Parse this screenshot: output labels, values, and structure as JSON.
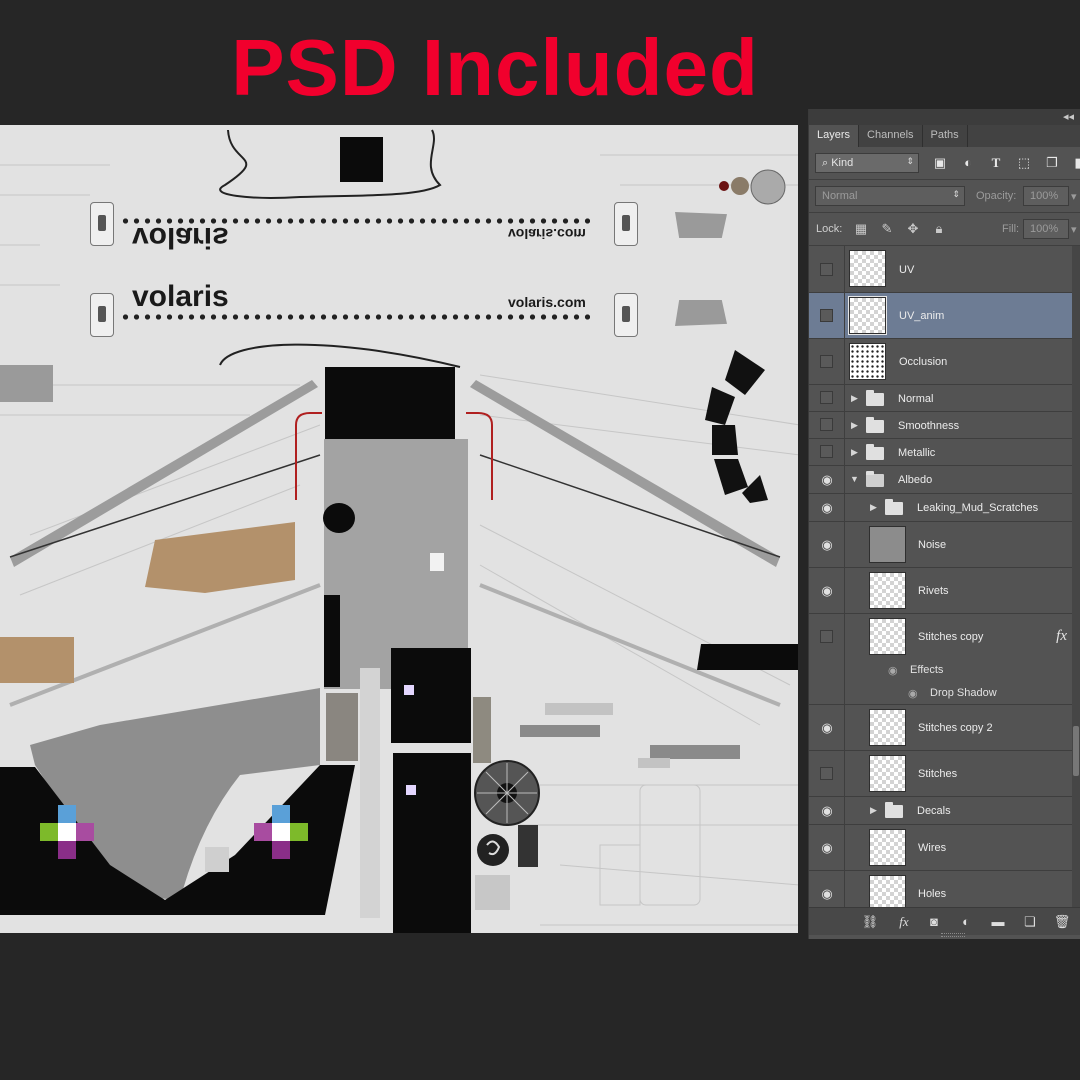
{
  "headline": "PSD Included",
  "texture": {
    "livery_brand": "volaris",
    "livery_url": "volaris.com"
  },
  "panel": {
    "tabs": [
      {
        "label": "Layers",
        "active": true
      },
      {
        "label": "Channels",
        "active": false
      },
      {
        "label": "Paths",
        "active": false
      }
    ],
    "filter": {
      "kind_label": "Kind",
      "icons": [
        "image-filter-icon",
        "adjustment-filter-icon",
        "type-filter-icon",
        "shape-filter-icon",
        "smart-object-filter-icon"
      ]
    },
    "blend_mode": "Normal",
    "opacity_label": "Opacity:",
    "opacity_value": "100%",
    "lock_label": "Lock:",
    "fill_label": "Fill:",
    "fill_value": "100%",
    "layers": [
      {
        "name": "UV",
        "type": "layer",
        "visible": false,
        "thumb": "checker"
      },
      {
        "name": "UV_anim",
        "type": "layer",
        "visible": false,
        "thumb": "checker",
        "selected": true
      },
      {
        "name": "Occlusion",
        "type": "layer",
        "visible": false,
        "thumb": "occlusion"
      },
      {
        "name": "Normal",
        "type": "group",
        "visible": false,
        "expanded": false
      },
      {
        "name": "Smoothness",
        "type": "group",
        "visible": false,
        "expanded": false
      },
      {
        "name": "Metallic",
        "type": "group",
        "visible": false,
        "expanded": false
      },
      {
        "name": "Albedo",
        "type": "group",
        "visible": true,
        "expanded": true
      },
      {
        "name": "Leaking_Mud_Scratches",
        "type": "group",
        "visible": true,
        "expanded": false,
        "indent": 1
      },
      {
        "name": "Noise",
        "type": "layer",
        "visible": true,
        "thumb": "solid",
        "indent": 1
      },
      {
        "name": "Rivets",
        "type": "layer",
        "visible": true,
        "thumb": "checker",
        "indent": 1
      },
      {
        "name": "Stitches copy",
        "type": "layer",
        "visible": false,
        "thumb": "checker",
        "indent": 1,
        "fx": "fx"
      },
      {
        "name": "Effects",
        "type": "effect-header"
      },
      {
        "name": "Drop Shadow",
        "type": "effect"
      },
      {
        "name": "Stitches copy 2",
        "type": "layer",
        "visible": true,
        "thumb": "checker",
        "indent": 1
      },
      {
        "name": "Stitches",
        "type": "layer",
        "visible": false,
        "thumb": "checker",
        "indent": 1
      },
      {
        "name": "Decals",
        "type": "group",
        "visible": true,
        "expanded": false,
        "indent": 1
      },
      {
        "name": "Wires",
        "type": "layer",
        "visible": true,
        "thumb": "checker",
        "indent": 1
      },
      {
        "name": "Holes",
        "type": "layer",
        "visible": true,
        "thumb": "checker",
        "indent": 1
      }
    ],
    "footer_icons": [
      "link-layers-icon",
      "add-style-icon",
      "add-mask-icon",
      "adjustment-layer-icon",
      "new-group-icon",
      "new-layer-icon",
      "delete-layer-icon"
    ]
  }
}
